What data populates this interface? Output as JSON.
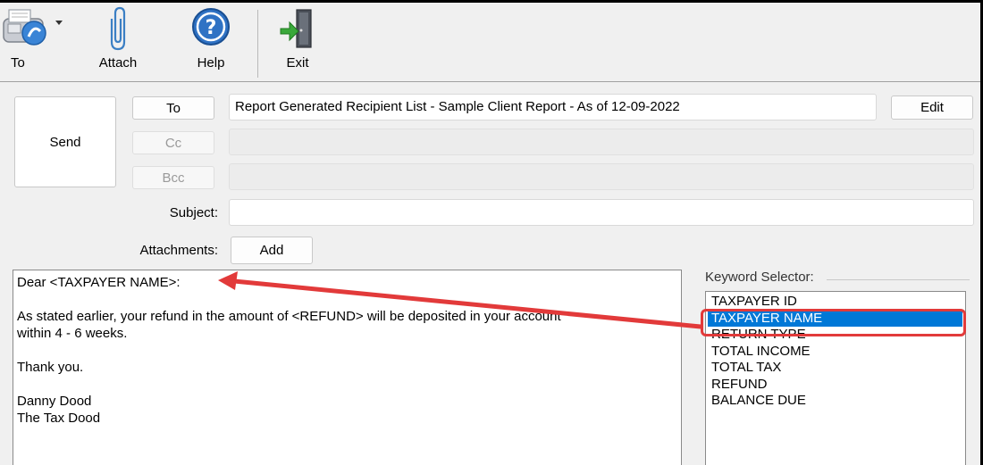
{
  "toolbar": {
    "to_label": "To",
    "attach_label": "Attach",
    "help_label": "Help",
    "exit_label": "Exit"
  },
  "compose": {
    "send_label": "Send",
    "to_button": "To",
    "cc_button": "Cc",
    "bcc_button": "Bcc",
    "edit_button": "Edit",
    "to_value": "Report Generated Recipient List - Sample Client Report - As of 12-09-2022",
    "cc_value": "",
    "bcc_value": "",
    "subject_label": "Subject:",
    "subject_value": "",
    "attachments_label": "Attachments:",
    "add_button": "Add"
  },
  "body": {
    "lines": [
      "Dear <TAXPAYER NAME>:",
      "",
      "As stated earlier, your refund in the amount of <REFUND> will be deposited in your account",
      "within 4 - 6 weeks.",
      "",
      "Thank you.",
      "",
      "Danny Dood",
      "The Tax Dood"
    ]
  },
  "keywords": {
    "title": "Keyword Selector:",
    "items": [
      "TAXPAYER ID",
      "TAXPAYER NAME",
      "RETURN TYPE",
      "TOTAL INCOME",
      "TOTAL TAX",
      "REFUND",
      "BALANCE DUE"
    ],
    "selected": "TAXPAYER NAME"
  },
  "colors": {
    "selection": "#0078d7",
    "annotation": "#e23a3a"
  },
  "icons": {
    "to": "fax-machine-icon",
    "attach": "paperclip-icon",
    "help": "help-question-icon",
    "exit": "exit-door-icon"
  }
}
